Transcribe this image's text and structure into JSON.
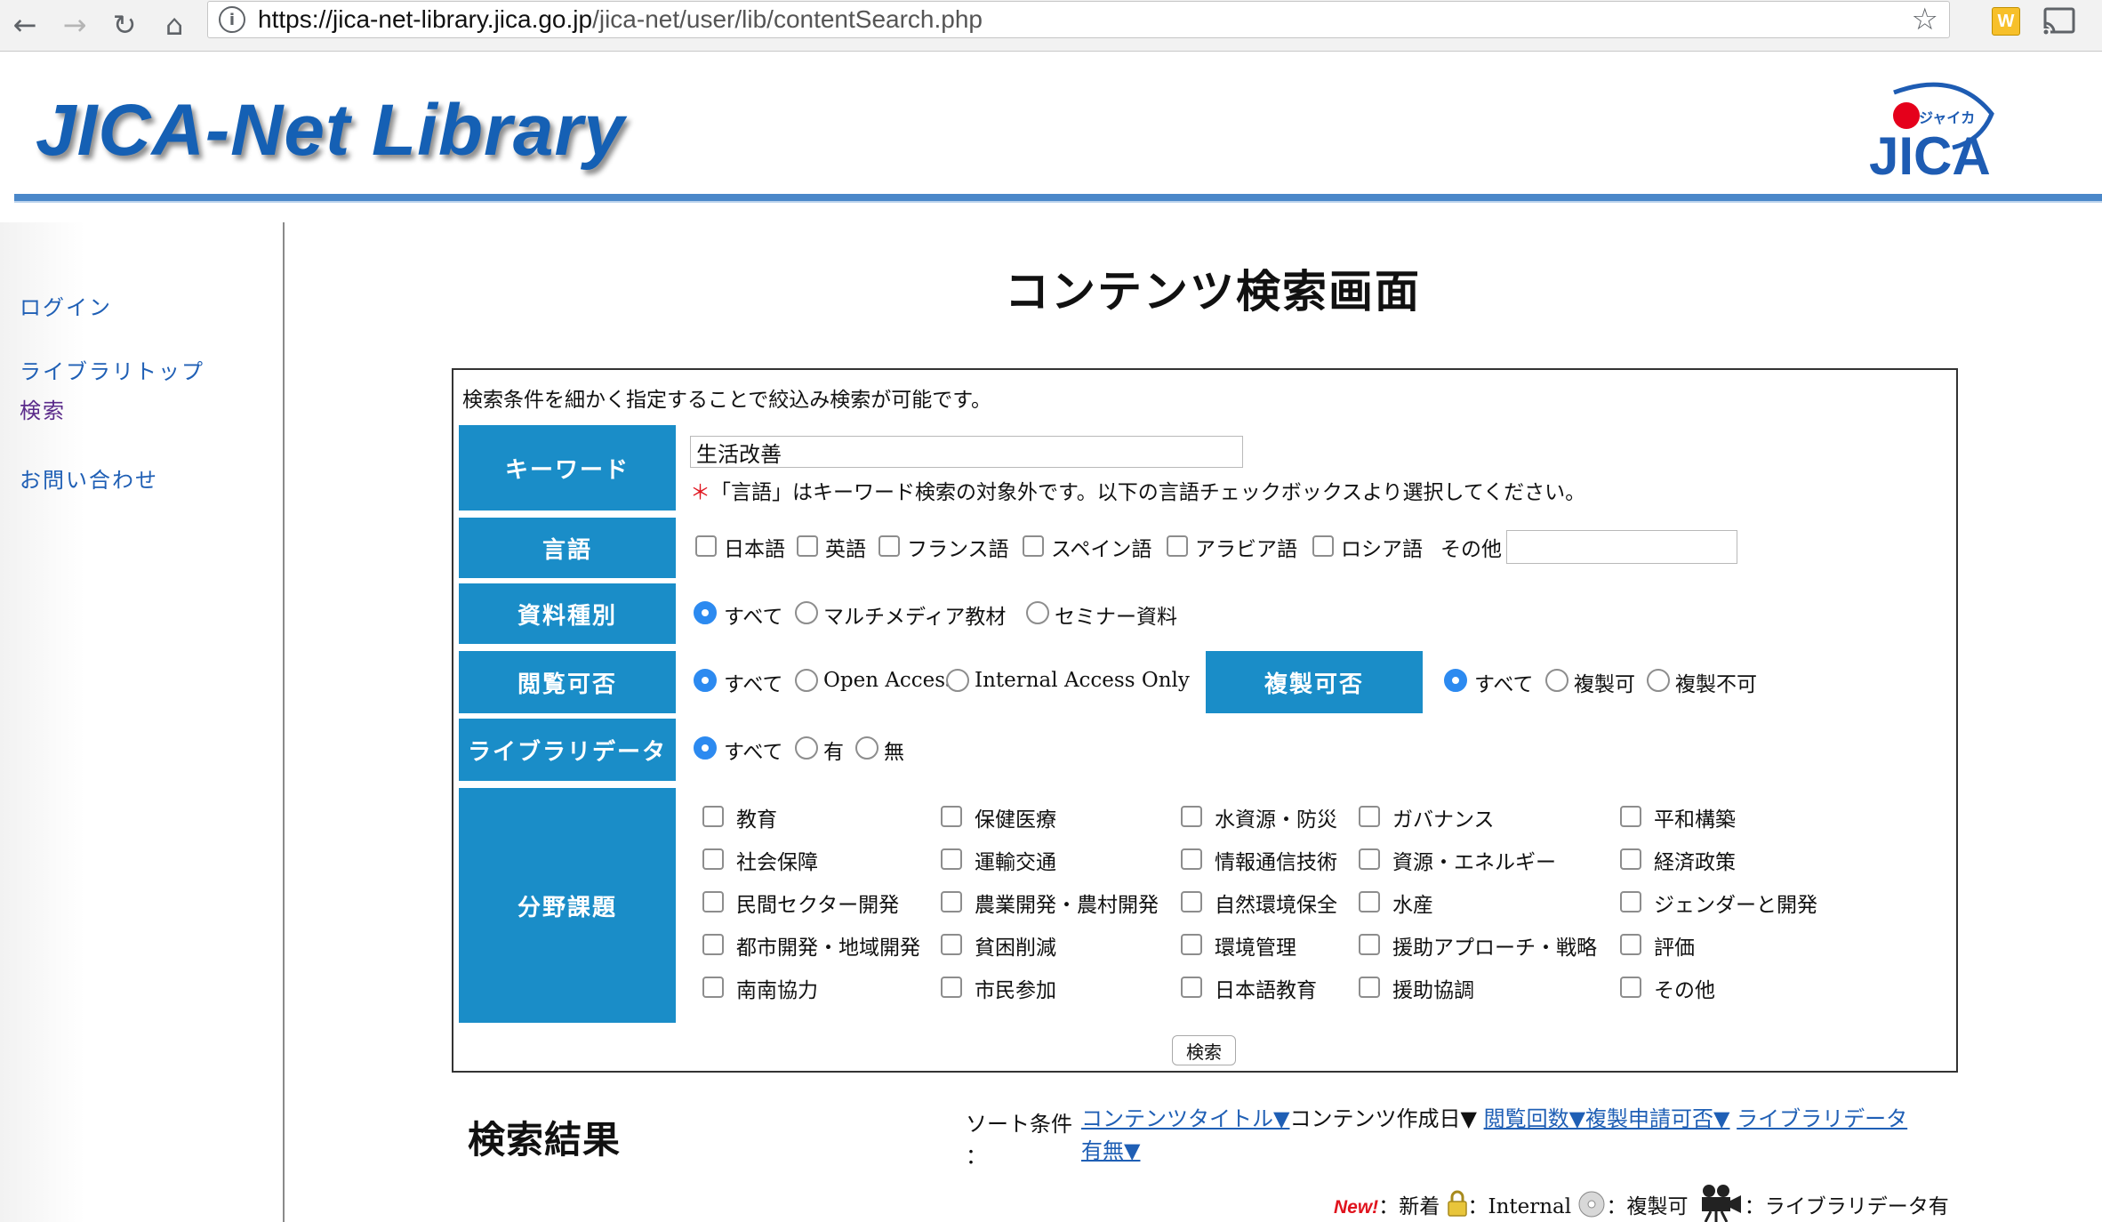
{
  "browser": {
    "url_host": "https://jica-net-library.jica.go.jp",
    "url_path": "/jica-net/user/lib/contentSearch.php",
    "extension_label": "W"
  },
  "header": {
    "site_logo": "JICA-Net Library",
    "org_logo": "JICA",
    "org_logo_kana": "ジャイカ",
    "colors": {
      "brand_blue": "#1560b4",
      "rule": "#4a87c9",
      "label_bg": "#1a8dc8"
    }
  },
  "sidebar": {
    "items": [
      {
        "label": "ログイン"
      },
      {
        "label": "ライブラリトップ"
      },
      {
        "label": "検索"
      },
      {
        "label": "お問い合わせ"
      }
    ]
  },
  "main": {
    "title": "コンテンツ検索画面",
    "intro": "検索条件を細かく指定することで絞込み検索が可能です。",
    "keyword": {
      "label": "キーワード",
      "value": "生活改善",
      "note_mark": "＊",
      "note": "「言語」はキーワード検索の対象外です。以下の言語チェックボックスより選択してください。"
    },
    "language": {
      "label": "言語",
      "options": [
        "日本語",
        "英語",
        "フランス語",
        "スペイン語",
        "アラビア語",
        "ロシア語"
      ],
      "other_label": "その他",
      "other_value": ""
    },
    "material_type": {
      "label": "資料種別",
      "options": [
        "すべて",
        "マルチメディア教材",
        "セミナー資料"
      ],
      "selected": "すべて"
    },
    "access": {
      "label": "閲覧可否",
      "options": [
        "すべて",
        "Open Access",
        "Internal Access Only"
      ],
      "selected": "すべて"
    },
    "copy": {
      "label": "複製可否",
      "options": [
        "すべて",
        "複製可",
        "複製不可"
      ],
      "selected": "すべて"
    },
    "library_data": {
      "label": "ライブラリデータ",
      "options": [
        "すべて",
        "有",
        "無"
      ],
      "selected": "すべて"
    },
    "fields": {
      "label": "分野課題",
      "columns": [
        [
          "教育",
          "社会保障",
          "民間セクター開発",
          "都市開発・地域開発",
          "南南協力"
        ],
        [
          "保健医療",
          "運輸交通",
          "農業開発・農村開発",
          "貧困削減",
          "市民参加"
        ],
        [
          "水資源・防災",
          "情報通信技術",
          "自然環境保全",
          "環境管理",
          "日本語教育"
        ],
        [
          "ガバナンス",
          "資源・エネルギー",
          "水産",
          "援助アプローチ・戦略",
          "援助協調"
        ],
        [
          "平和構築",
          "経済政策",
          "ジェンダーと開発",
          "評価",
          "その他"
        ]
      ]
    },
    "search_button": "検索"
  },
  "results": {
    "title": "検索結果",
    "sort_label": "ソート条件",
    "sort_colon": "：",
    "sort_options": {
      "title": "コンテンツタイトル▼",
      "created": "コンテンツ作成日▼",
      "views": "閲覧回数▼",
      "copy_request": "複製申請可否▼",
      "library_data_1": "ライブラリデータ",
      "library_data_2": "有無▼"
    },
    "legend": {
      "new_badge": "New!",
      "new": "：新着",
      "internal": "：Internal",
      "copyable": "：複製可",
      "library_data": "：ライブラリデータ有"
    }
  }
}
